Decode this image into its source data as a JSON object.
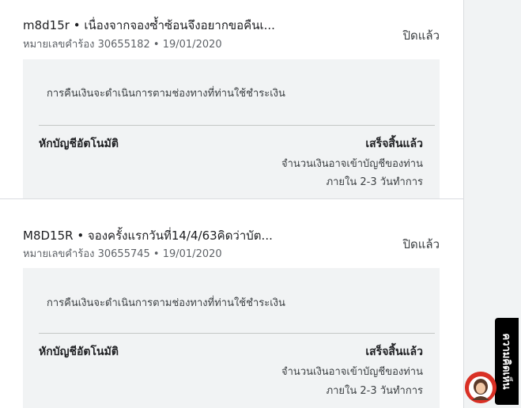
{
  "claims": [
    {
      "title": "m8d15r • เนื่องจากจองซ้ำซ้อนจึงอยากขอคืนเ...",
      "subtitle": "หมายเลขคำร้อง 30655182 • 19/01/2020",
      "status": "ปิดแล้ว",
      "note": "การคืนเงินจะดำเนินการตามช่องทางที่ท่านใช้ชำระเงิน",
      "method": "หักบัญชีอัตโนมัติ",
      "state": "เสร็จสิ้นแล้ว",
      "info_line1": "จำนวนเงินอาจเข้าบัญชีของท่าน",
      "info_line2": "ภายใน 2-3 วันทำการ"
    },
    {
      "title": "M8D15R • จองครั้งแรกวันที่14/4/63คิดว่าบัต...",
      "subtitle": "หมายเลขคำร้อง 30655745 • 19/01/2020",
      "status": "ปิดแล้ว",
      "note": "การคืนเงินจะดำเนินการตามช่องทางที่ท่านใช้ชำระเงิน",
      "method": "หักบัญชีอัตโนมัติ",
      "state": "เสร็จสิ้นแล้ว",
      "info_line1": "จำนวนเงินอาจเข้าบัญชีของท่าน",
      "info_line2": "ภายใน 2-3 วันทำการ"
    }
  ],
  "feedback": {
    "label": "ความคิดเห็น"
  },
  "colors": {
    "panel": "#f1f3f4",
    "divider": "#dadce0",
    "feedback_bg": "#000000",
    "avatar": "#d93025"
  },
  "icons": {
    "avatar": "user-avatar-icon"
  }
}
